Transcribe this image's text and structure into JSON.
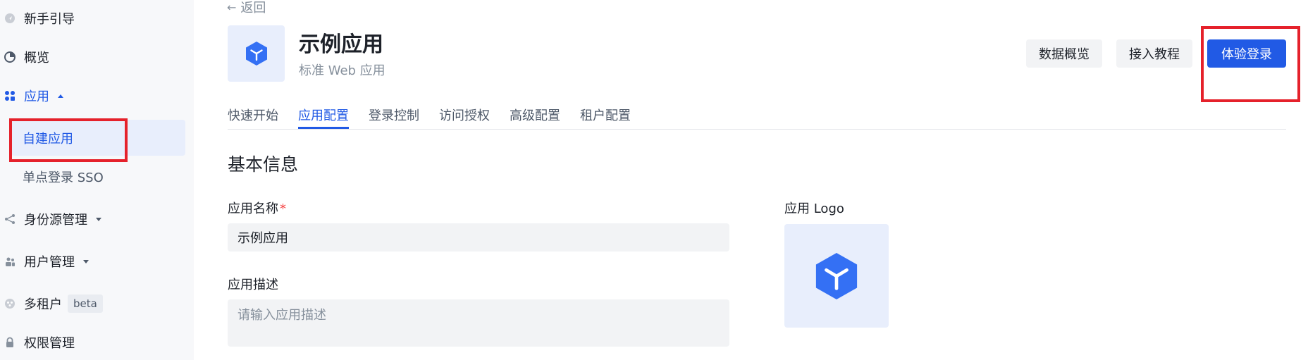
{
  "sidebar": {
    "items": [
      {
        "label": "新手引导",
        "icon": "guide-icon"
      },
      {
        "label": "概览",
        "icon": "pie-chart-icon"
      },
      {
        "label": "应用",
        "icon": "apps-icon"
      },
      {
        "label": "身份源管理",
        "icon": "share-icon"
      },
      {
        "label": "用户管理",
        "icon": "users-icon"
      },
      {
        "label": "多租户",
        "icon": "tenant-icon",
        "badge": "beta"
      },
      {
        "label": "权限管理",
        "icon": "lock-icon"
      }
    ],
    "sub_items": [
      {
        "label": "自建应用"
      },
      {
        "label": "单点登录 SSO"
      }
    ]
  },
  "header": {
    "back_label": "返回",
    "app_name": "示例应用",
    "app_type": "标准 Web 应用",
    "buttons": {
      "overview": "数据概览",
      "tutorial": "接入教程",
      "try_login": "体验登录"
    }
  },
  "tabs": [
    {
      "label": "快速开始"
    },
    {
      "label": "应用配置",
      "active": true
    },
    {
      "label": "登录控制"
    },
    {
      "label": "访问授权"
    },
    {
      "label": "高级配置"
    },
    {
      "label": "租户配置"
    }
  ],
  "form": {
    "section_title": "基本信息",
    "name_label": "应用名称",
    "required_mark": "*",
    "name_value": "示例应用",
    "desc_label": "应用描述",
    "desc_placeholder": "请输入应用描述",
    "logo_label": "应用 Logo"
  },
  "colors": {
    "accent": "#215ae5",
    "highlight_box": "#e5212b",
    "sidebar_bg": "#f7f8fa",
    "input_bg": "#f2f3f5"
  }
}
